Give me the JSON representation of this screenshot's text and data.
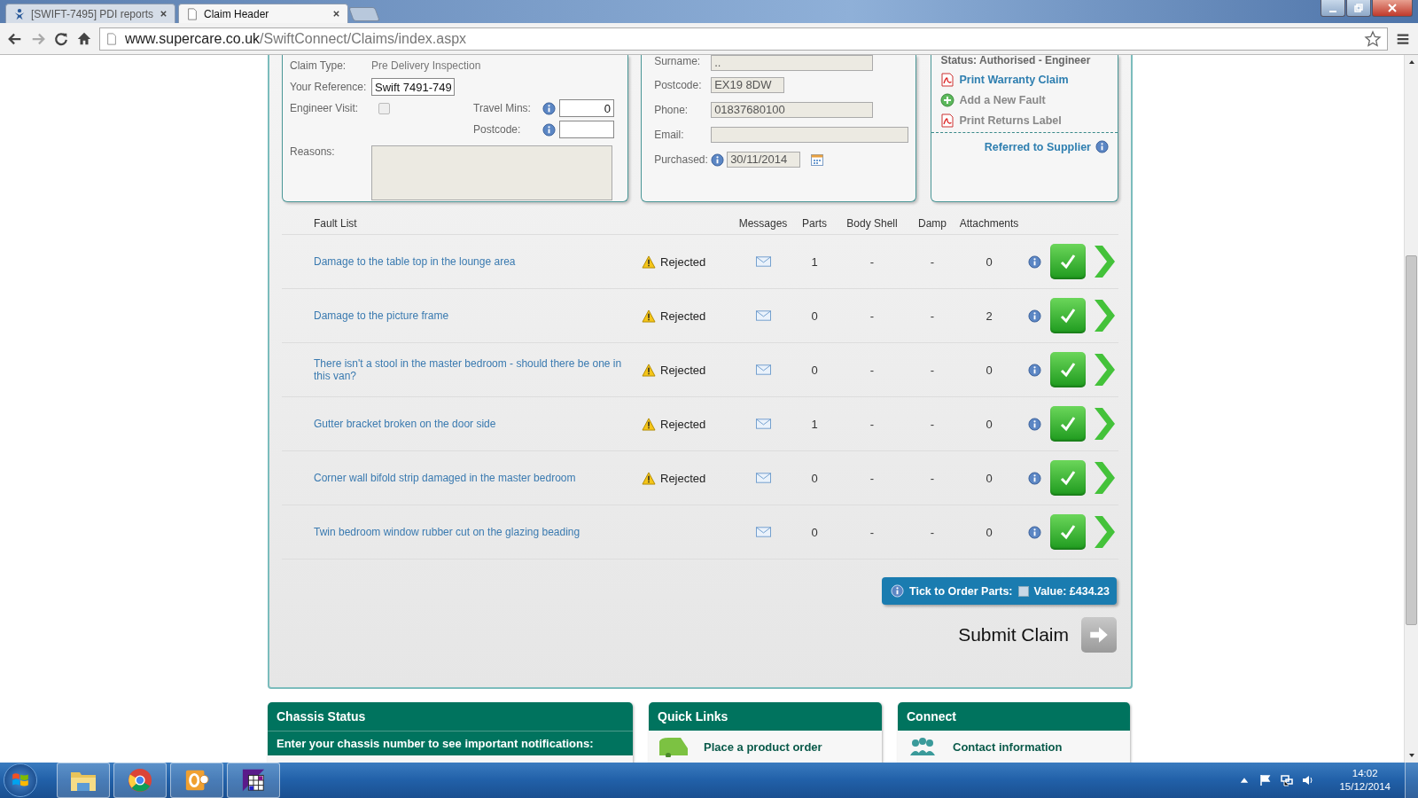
{
  "browser": {
    "tabs": [
      {
        "title": "[SWIFT-7495] PDI reports",
        "kind": "jira",
        "selected": false
      },
      {
        "title": "Claim Header",
        "kind": "page",
        "selected": true
      }
    ],
    "url_domain": "www.supercare.co.uk",
    "url_path": "/SwiftConnect/Claims/index.aspx"
  },
  "claim": {
    "claim_type_label": "Claim Type:",
    "claim_type": "Pre Delivery Inspection",
    "reference_label": "Your Reference:",
    "reference": "Swift 7491-749",
    "engineer_visit": {
      "label": "Engineer Visit:",
      "checked": false,
      "disabled": true
    },
    "travel_mins_label": "Travel Mins:",
    "travel_mins": "0",
    "postcode_label": "Postcode:",
    "reasons_label": "Reasons:"
  },
  "customer": {
    "surname_label": "Surname:",
    "surname": "..",
    "postcode_label": "Postcode:",
    "postcode": "EX19 8DW",
    "phone_label": "Phone:",
    "phone": "01837680100",
    "email_label": "Email:",
    "purchased_label": "Purchased:",
    "purchased": "30/11/2014"
  },
  "status_panel": {
    "status": "Status: Authorised - Engineer",
    "actions": [
      {
        "label": "Print Warranty Claim",
        "kind": "pdf",
        "disabled": false
      },
      {
        "label": "Add a New Fault",
        "kind": "add",
        "disabled": true
      },
      {
        "label": "Print Returns Label",
        "kind": "pdf",
        "disabled": true
      }
    ],
    "referred": "Referred to Supplier"
  },
  "fault_table": {
    "columns": [
      "Fault List",
      "Messages",
      "Parts",
      "Body Shell",
      "Damp",
      "Attachments"
    ],
    "rows": [
      {
        "description": "Damage to the table top in the lounge area",
        "status": "Rejected",
        "parts": "1",
        "body_shell": "-",
        "damp": "-",
        "attachments": "0"
      },
      {
        "description": "Damage to the picture frame",
        "status": "Rejected",
        "parts": "0",
        "body_shell": "-",
        "damp": "-",
        "attachments": "2"
      },
      {
        "description": "There isn't a stool in the master bedroom - should there be one in this van?",
        "status": "Rejected",
        "parts": "0",
        "body_shell": "-",
        "damp": "-",
        "attachments": "0"
      },
      {
        "description": "Gutter bracket broken on the door side",
        "status": "Rejected",
        "parts": "1",
        "body_shell": "-",
        "damp": "-",
        "attachments": "0"
      },
      {
        "description": "Corner wall bifold strip damaged in the master bedroom",
        "status": "Rejected",
        "parts": "0",
        "body_shell": "-",
        "damp": "-",
        "attachments": "0"
      },
      {
        "description": "Twin bedroom window rubber cut on the glazing beading",
        "parts": "0",
        "body_shell": "-",
        "damp": "-",
        "attachments": "0"
      }
    ]
  },
  "order_parts": {
    "label": "Tick to Order Parts:",
    "checked": false,
    "value": "Value: £434.23"
  },
  "submit": {
    "label": "Submit Claim"
  },
  "footer_cards": [
    {
      "title": "Chassis Status",
      "kind": "text",
      "text": "Enter your chassis number to see important notifications:"
    },
    {
      "title": "Quick Links",
      "kind": "order",
      "text": "Place a product order"
    },
    {
      "title": "Connect",
      "kind": "contact",
      "text": "Contact information"
    }
  ],
  "taskbar": {
    "apps": [
      {
        "kind": "folder"
      },
      {
        "kind": "chrome"
      },
      {
        "kind": "outlook"
      },
      {
        "kind": "grid"
      }
    ],
    "time": "14:02",
    "date": "15/12/2014"
  }
}
